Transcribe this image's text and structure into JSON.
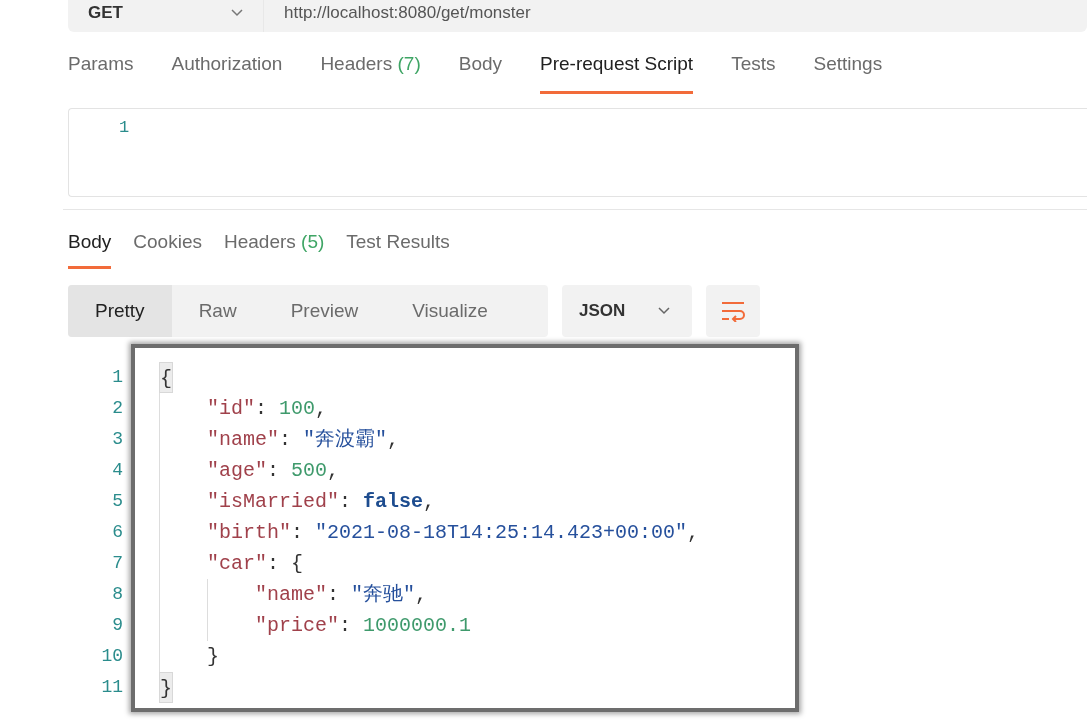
{
  "request": {
    "method": "GET",
    "url": "http://localhost:8080/get/monster"
  },
  "request_tabs": [
    {
      "label": "Params",
      "selected": false
    },
    {
      "label": "Authorization",
      "selected": false
    },
    {
      "label": "Headers",
      "count": "(7)",
      "selected": false
    },
    {
      "label": "Body",
      "selected": false
    },
    {
      "label": "Pre-request Script",
      "selected": true
    },
    {
      "label": "Tests",
      "selected": false
    },
    {
      "label": "Settings",
      "selected": false
    }
  ],
  "script_editor": {
    "line_numbers": [
      "1"
    ]
  },
  "response_tabs": [
    {
      "label": "Body",
      "selected": true
    },
    {
      "label": "Cookies",
      "selected": false
    },
    {
      "label": "Headers",
      "count": "(5)",
      "selected": false
    },
    {
      "label": "Test Results",
      "selected": false
    }
  ],
  "view_modes": [
    {
      "label": "Pretty",
      "selected": true
    },
    {
      "label": "Raw",
      "selected": false
    },
    {
      "label": "Preview",
      "selected": false
    },
    {
      "label": "Visualize",
      "selected": false
    }
  ],
  "format": "JSON",
  "response_lines": [
    {
      "no": "1",
      "tokens": [
        {
          "kind": "brace",
          "text": "{"
        }
      ],
      "children": [
        {
          "no": "2",
          "tokens": [
            {
              "kind": "key",
              "text": "\"id\""
            },
            {
              "kind": "punct",
              "text": ": "
            },
            {
              "kind": "number",
              "text": "100"
            },
            {
              "kind": "punct",
              "text": ","
            }
          ]
        },
        {
          "no": "3",
          "tokens": [
            {
              "kind": "key",
              "text": "\"name\""
            },
            {
              "kind": "punct",
              "text": ": "
            },
            {
              "kind": "string",
              "text": "\"奔波霸\""
            },
            {
              "kind": "punct",
              "text": ","
            }
          ]
        },
        {
          "no": "4",
          "tokens": [
            {
              "kind": "key",
              "text": "\"age\""
            },
            {
              "kind": "punct",
              "text": ": "
            },
            {
              "kind": "number",
              "text": "500"
            },
            {
              "kind": "punct",
              "text": ","
            }
          ]
        },
        {
          "no": "5",
          "tokens": [
            {
              "kind": "key",
              "text": "\"isMarried\""
            },
            {
              "kind": "punct",
              "text": ": "
            },
            {
              "kind": "bool",
              "text": "false"
            },
            {
              "kind": "punct",
              "text": ","
            }
          ]
        },
        {
          "no": "6",
          "tokens": [
            {
              "kind": "key",
              "text": "\"birth\""
            },
            {
              "kind": "punct",
              "text": ": "
            },
            {
              "kind": "string",
              "text": "\"2021-08-18T14:25:14.423+00:00\""
            },
            {
              "kind": "punct",
              "text": ","
            }
          ]
        },
        {
          "no": "7",
          "tokens": [
            {
              "kind": "key",
              "text": "\"car\""
            },
            {
              "kind": "punct",
              "text": ": {"
            }
          ],
          "children": [
            {
              "no": "8",
              "tokens": [
                {
                  "kind": "key",
                  "text": "\"name\""
                },
                {
                  "kind": "punct",
                  "text": ": "
                },
                {
                  "kind": "string",
                  "text": "\"奔驰\""
                },
                {
                  "kind": "punct",
                  "text": ","
                }
              ]
            },
            {
              "no": "9",
              "tokens": [
                {
                  "kind": "key",
                  "text": "\"price\""
                },
                {
                  "kind": "punct",
                  "text": ": "
                },
                {
                  "kind": "number",
                  "text": "1000000.1"
                }
              ]
            }
          ]
        },
        {
          "no": "10",
          "tokens": [
            {
              "kind": "punct",
              "text": "}"
            }
          ]
        }
      ]
    },
    {
      "no": "11",
      "tokens": [
        {
          "kind": "brace",
          "text": "}"
        }
      ]
    }
  ]
}
